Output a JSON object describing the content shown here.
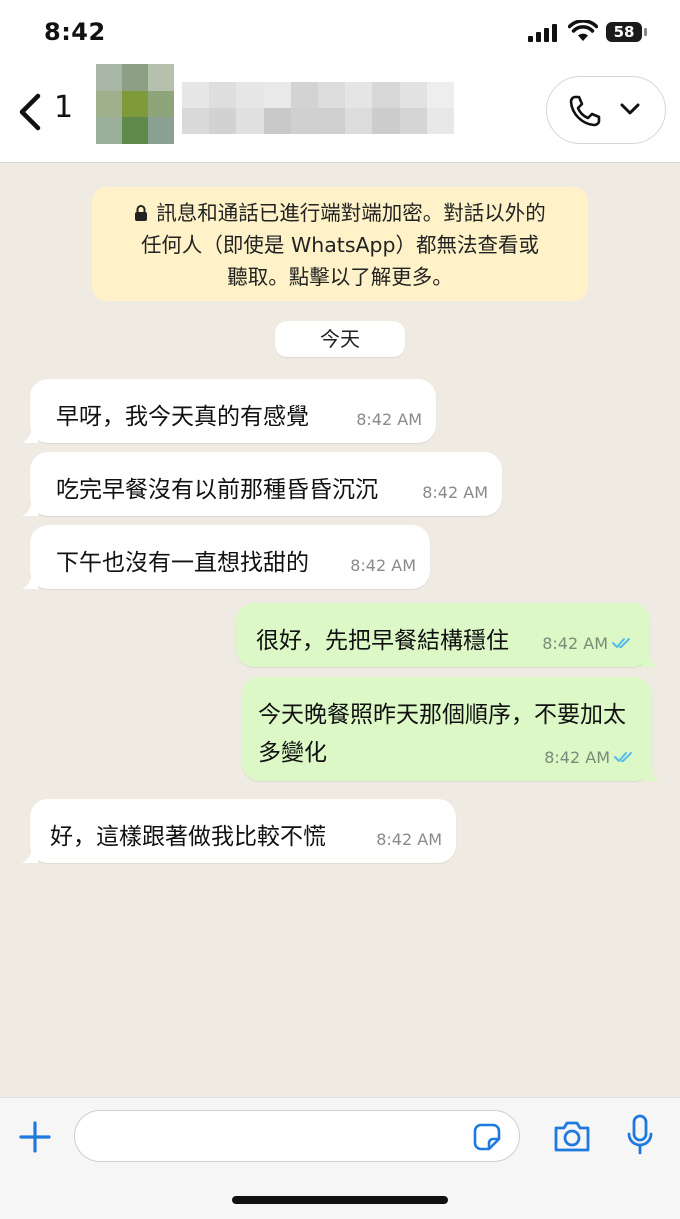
{
  "status_bar": {
    "time": "8:42",
    "battery": "58"
  },
  "header": {
    "unread_count": "1",
    "avatar_tiles": [
      "#a7b6a5",
      "#8c9f83",
      "#b6c1ad",
      "#a0b08d",
      "#7f9a3a",
      "#8ea57c",
      "#9bb09a",
      "#5f8a4c",
      "#8aa093"
    ],
    "name_tiles": [
      "#e7e7e7",
      "#dedede",
      "#e6e6e6",
      "#e9e9e9",
      "#d3d3d3",
      "#dcdcdc",
      "#e5e5e5",
      "#d7d7d7",
      "#e2e2e2",
      "#eeeeee",
      "#dadada",
      "#d2d2d2",
      "#e0e0e0",
      "#c9c9c9",
      "#d0d0d0",
      "#cfcfcf",
      "#dcdcdc",
      "#cccccc",
      "#d5d5d5",
      "#e8e8e8"
    ]
  },
  "encryption_notice": {
    "line1": "訊息和通話已進行端對端加密。對話以外的",
    "line2": "任何人（即使是 WhatsApp）都無法查看或",
    "line3": "聽取。點擊以了解更多。"
  },
  "day_label": "今天",
  "messages": [
    {
      "direction": "in",
      "lines": [
        "早呀，我今天真的有感覺"
      ],
      "time": "8:42 AM"
    },
    {
      "direction": "in",
      "lines": [
        "吃完早餐沒有以前那種昏昏沉沉"
      ],
      "time": "8:42 AM"
    },
    {
      "direction": "in",
      "lines": [
        "下午也沒有一直想找甜的"
      ],
      "time": "8:42 AM"
    },
    {
      "direction": "out",
      "lines": [
        "很好，先把早餐結構穩住"
      ],
      "time": "8:42 AM",
      "read": true
    },
    {
      "direction": "out",
      "lines": [
        "今天晚餐照昨天那個順序，不要加太",
        "多變化"
      ],
      "time": "8:42 AM",
      "read": true
    },
    {
      "direction": "in",
      "lines": [
        "好，這樣跟著做我比較不慌"
      ],
      "time": "8:42 AM"
    }
  ],
  "input": {
    "value": "",
    "placeholder": ""
  },
  "colors": {
    "read_ticks": "#53bdeb",
    "accent": "#1f7ae0",
    "outgoing_bubble": "#dcf8c6",
    "encryption_bg": "#fff2c8"
  }
}
